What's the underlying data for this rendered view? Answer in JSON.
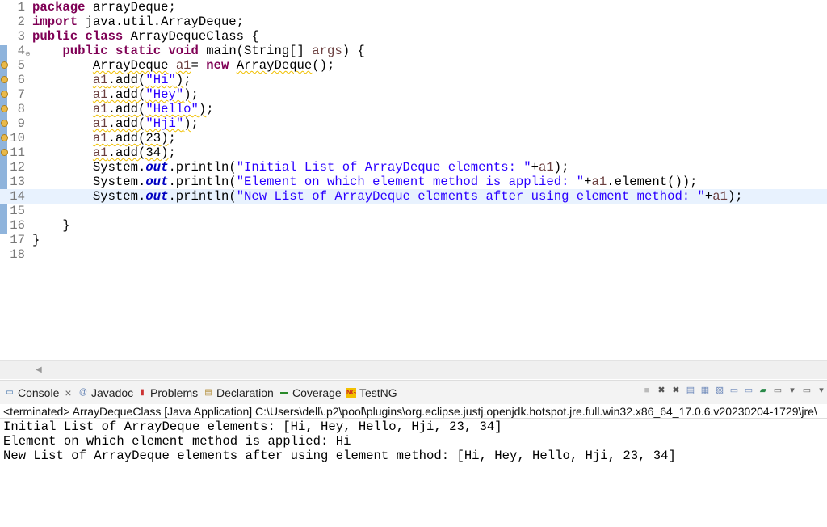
{
  "editor": {
    "current_line": 14,
    "lines": [
      {
        "n": "1",
        "tokens": [
          {
            "t": "package",
            "c": "kw"
          },
          {
            "t": " arrayDeque;",
            "c": "plain"
          }
        ]
      },
      {
        "n": "2",
        "tokens": [
          {
            "t": "import",
            "c": "kw"
          },
          {
            "t": " java.util.ArrayDeque;",
            "c": "plain"
          }
        ]
      },
      {
        "n": "3",
        "tokens": [
          {
            "t": "public class",
            "c": "kw"
          },
          {
            "t": " ArrayDequeClass {",
            "c": "plain"
          }
        ]
      },
      {
        "n": "4",
        "fold": true,
        "tokens": [
          {
            "t": "    ",
            "c": "plain"
          },
          {
            "t": "public static void",
            "c": "kw"
          },
          {
            "t": " main(String[] ",
            "c": "plain"
          },
          {
            "t": "args",
            "c": "var"
          },
          {
            "t": ") {",
            "c": "plain"
          }
        ]
      },
      {
        "n": "5",
        "warn": true,
        "tokens": [
          {
            "t": "        ",
            "c": "plain"
          },
          {
            "t": "ArrayDeque",
            "c": "plain warn"
          },
          {
            "t": " ",
            "c": "plain"
          },
          {
            "t": "a1",
            "c": "var warn"
          },
          {
            "t": "= ",
            "c": "plain"
          },
          {
            "t": "new",
            "c": "kw"
          },
          {
            "t": " ",
            "c": "plain"
          },
          {
            "t": "ArrayDeque",
            "c": "plain warn"
          },
          {
            "t": "();",
            "c": "plain"
          }
        ]
      },
      {
        "n": "6",
        "warn": true,
        "tokens": [
          {
            "t": "        ",
            "c": "plain"
          },
          {
            "t": "a1",
            "c": "var warn"
          },
          {
            "t": ".add(",
            "c": "plain warn"
          },
          {
            "t": "\"Hi\"",
            "c": "str warn"
          },
          {
            "t": ")",
            "c": "plain warn"
          },
          {
            "t": ";",
            "c": "plain"
          }
        ]
      },
      {
        "n": "7",
        "warn": true,
        "tokens": [
          {
            "t": "        ",
            "c": "plain"
          },
          {
            "t": "a1",
            "c": "var warn"
          },
          {
            "t": ".add(",
            "c": "plain warn"
          },
          {
            "t": "\"Hey\"",
            "c": "str warn"
          },
          {
            "t": ")",
            "c": "plain warn"
          },
          {
            "t": ";",
            "c": "plain"
          }
        ]
      },
      {
        "n": "8",
        "warn": true,
        "tokens": [
          {
            "t": "        ",
            "c": "plain"
          },
          {
            "t": "a1",
            "c": "var warn"
          },
          {
            "t": ".add(",
            "c": "plain warn"
          },
          {
            "t": "\"Hello\"",
            "c": "str warn"
          },
          {
            "t": ")",
            "c": "plain warn"
          },
          {
            "t": ";",
            "c": "plain"
          }
        ]
      },
      {
        "n": "9",
        "warn": true,
        "tokens": [
          {
            "t": "        ",
            "c": "plain"
          },
          {
            "t": "a1",
            "c": "var warn"
          },
          {
            "t": ".add(",
            "c": "plain warn"
          },
          {
            "t": "\"Hji\"",
            "c": "str warn"
          },
          {
            "t": ")",
            "c": "plain warn"
          },
          {
            "t": ";",
            "c": "plain"
          }
        ]
      },
      {
        "n": "10",
        "warn": true,
        "tokens": [
          {
            "t": "        ",
            "c": "plain"
          },
          {
            "t": "a1",
            "c": "var warn"
          },
          {
            "t": ".add(23)",
            "c": "plain warn"
          },
          {
            "t": ";",
            "c": "plain"
          }
        ]
      },
      {
        "n": "11",
        "warn": true,
        "tokens": [
          {
            "t": "        ",
            "c": "plain"
          },
          {
            "t": "a1",
            "c": "var warn"
          },
          {
            "t": ".add(34)",
            "c": "plain warn"
          },
          {
            "t": ";",
            "c": "plain"
          }
        ]
      },
      {
        "n": "12",
        "tokens": [
          {
            "t": "        System.",
            "c": "plain"
          },
          {
            "t": "out",
            "c": "fld"
          },
          {
            "t": ".println(",
            "c": "plain"
          },
          {
            "t": "\"Initial List of ArrayDeque elements: \"",
            "c": "str"
          },
          {
            "t": "+",
            "c": "plain"
          },
          {
            "t": "a1",
            "c": "var"
          },
          {
            "t": ");",
            "c": "plain"
          }
        ]
      },
      {
        "n": "13",
        "tokens": [
          {
            "t": "        System.",
            "c": "plain"
          },
          {
            "t": "out",
            "c": "fld"
          },
          {
            "t": ".println(",
            "c": "plain"
          },
          {
            "t": "\"Element on which element method is applied: \"",
            "c": "str"
          },
          {
            "t": "+",
            "c": "plain"
          },
          {
            "t": "a1",
            "c": "var"
          },
          {
            "t": ".element());",
            "c": "plain"
          }
        ]
      },
      {
        "n": "14",
        "tokens": [
          {
            "t": "        System.",
            "c": "plain"
          },
          {
            "t": "out",
            "c": "fld"
          },
          {
            "t": ".println(",
            "c": "plain"
          },
          {
            "t": "\"New List of ArrayDeque elements after using element method: \"",
            "c": "str"
          },
          {
            "t": "+",
            "c": "plain"
          },
          {
            "t": "a1",
            "c": "var"
          },
          {
            "t": ");",
            "c": "plain"
          }
        ]
      },
      {
        "n": "15",
        "tokens": []
      },
      {
        "n": "16",
        "tokens": [
          {
            "t": "    }",
            "c": "plain"
          }
        ]
      },
      {
        "n": "17",
        "tokens": [
          {
            "t": "}",
            "c": "plain"
          }
        ]
      },
      {
        "n": "18",
        "tokens": []
      }
    ]
  },
  "console": {
    "tabs": [
      {
        "label": "Console",
        "icon": "console-icon",
        "active": true,
        "closable": true
      },
      {
        "label": "Javadoc",
        "icon": "javadoc-icon"
      },
      {
        "label": "Problems",
        "icon": "problems-icon"
      },
      {
        "label": "Declaration",
        "icon": "declaration-icon"
      },
      {
        "label": "Coverage",
        "icon": "coverage-icon"
      },
      {
        "label": "TestNG",
        "icon": "testng-icon"
      }
    ],
    "close_glyph": "×",
    "status": "<terminated> ArrayDequeClass [Java Application] C:\\Users\\dell\\.p2\\pool\\plugins\\org.eclipse.justj.openjdk.hotspot.jre.full.win32.x86_64_17.0.6.v20230204-1729\\jre\\",
    "output": [
      "Initial List of ArrayDeque elements: [Hi, Hey, Hello, Hji, 23, 34]",
      "Element on which element method is applied: Hi",
      "New List of ArrayDeque elements after using element method: [Hi, Hey, Hello, Hji, 23, 34]"
    ],
    "toolbar_icons": [
      "terminate-icon",
      "remove-launch-icon",
      "remove-all-icon",
      "clear-console-icon",
      "scroll-lock-icon",
      "word-wrap-icon",
      "show-on-stdout-icon",
      "show-on-stderr-icon",
      "pin-console-icon",
      "display-console-icon",
      "dropdown-icon",
      "open-console-icon",
      "view-menu-icon"
    ]
  }
}
